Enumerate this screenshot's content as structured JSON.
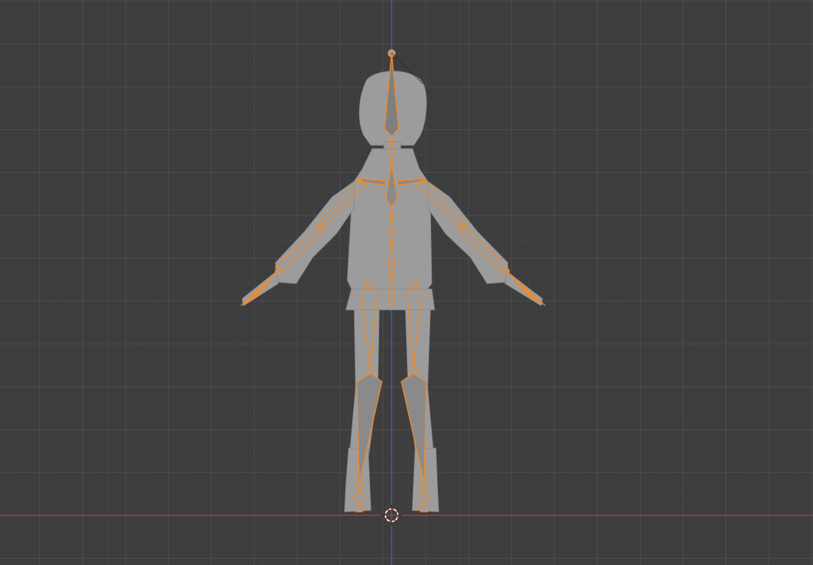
{
  "viewport": {
    "mode": "3d-viewport-front-orthographic",
    "background_color": "#3d3d3d",
    "grid_color": "#505050",
    "x_axis_color": "#b34050",
    "z_axis_color": "#3f6fb5",
    "armature_color": "#f08a2a",
    "mesh_color": "#9b9b9b",
    "cursor_icon": "3d-cursor-icon"
  }
}
